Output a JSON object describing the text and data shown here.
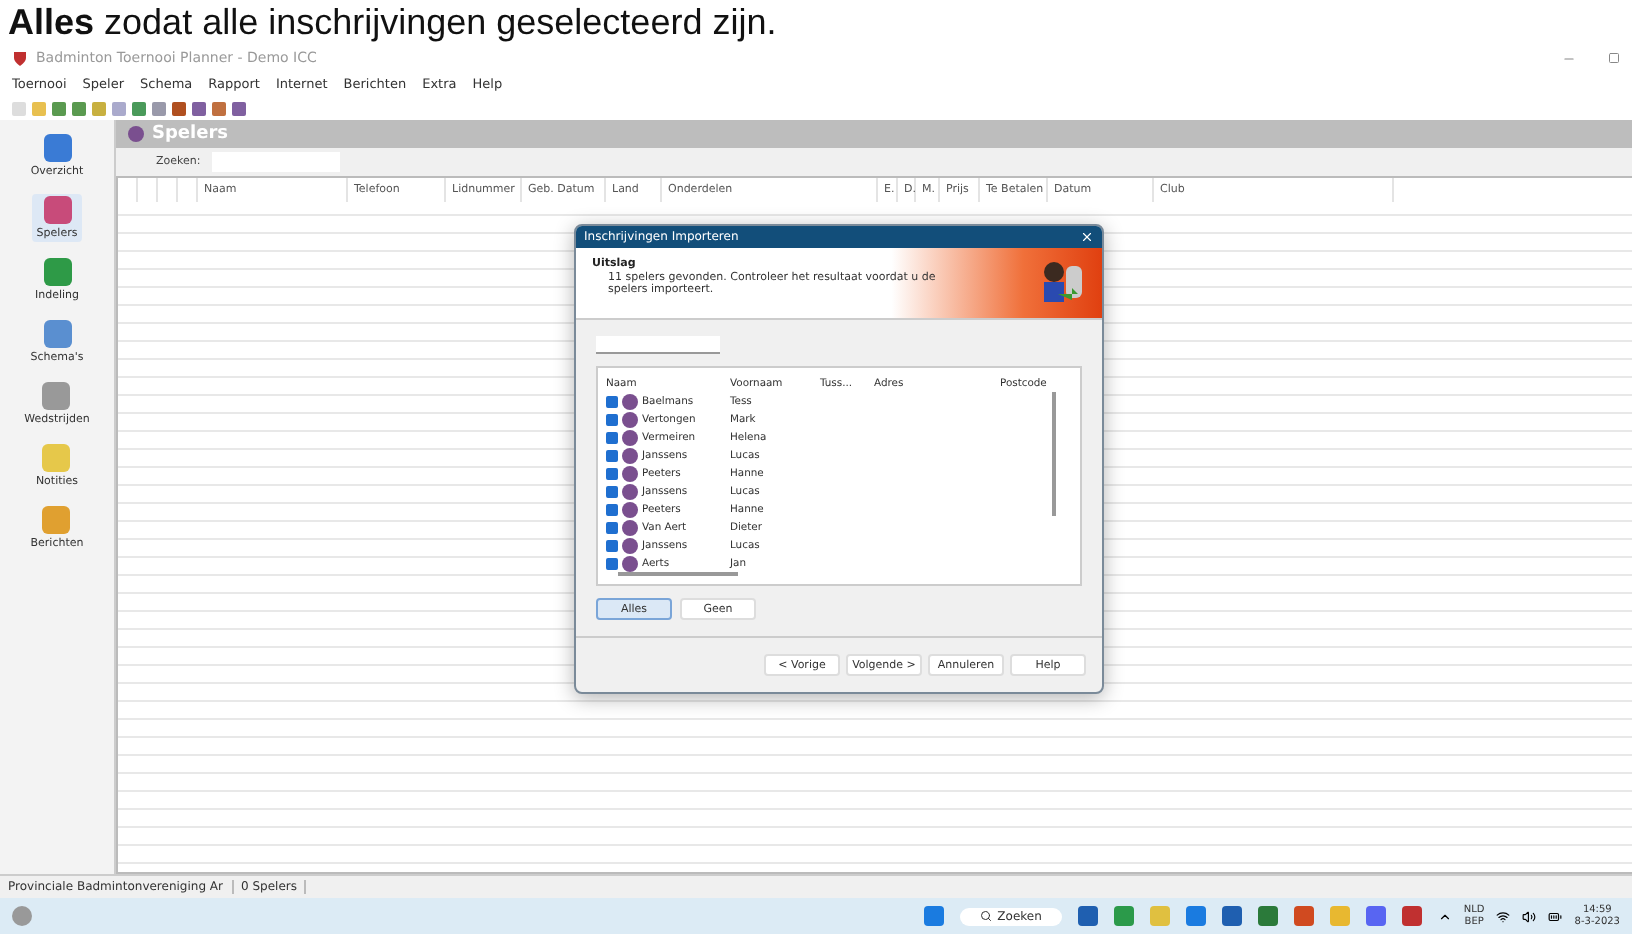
{
  "caption": "**Alles** zodat alle inschrijvingen geselecteerd zijn.",
  "window": {
    "title": "Badminton Toernooi Planner - Demo ICC"
  },
  "menu": [
    "Toernooi",
    "Speler",
    "Schema",
    "Rapport",
    "Internet",
    "Berichten",
    "Extra",
    "Help"
  ],
  "sidebar": {
    "items": [
      {
        "label": "Overzicht",
        "selected": false
      },
      {
        "label": "Spelers",
        "selected": true
      },
      {
        "label": "Indeling",
        "selected": false
      },
      {
        "label": "Schema's",
        "selected": false
      },
      {
        "label": "Wedstrijden",
        "selected": false
      },
      {
        "label": "Notities",
        "selected": false
      },
      {
        "label": "Berichten",
        "selected": false
      }
    ]
  },
  "panel": {
    "title": "Spelers",
    "search_label": "Zoeken:"
  },
  "table": {
    "columns": [
      "",
      "",
      "",
      "",
      "Naam",
      "Telefoon",
      "Lidnummer",
      "Geb. Datum",
      "Land",
      "Onderdelen",
      "E.",
      "D.",
      "M.",
      "Prijs",
      "Te Betalen",
      "Datum",
      "Club"
    ]
  },
  "dialog": {
    "title": "Inschrijvingen Importeren",
    "heading": "Uitslag",
    "message": "11 spelers gevonden. Controleer het resultaat voordat u de spelers importeert.",
    "columns": [
      "Naam",
      "Voornaam",
      "Tuss...",
      "Adres",
      "Postcode"
    ],
    "rows": [
      {
        "checked": true,
        "naam": "Baelmans",
        "voornaam": "Tess"
      },
      {
        "checked": true,
        "naam": "Vertongen",
        "voornaam": "Mark"
      },
      {
        "checked": true,
        "naam": "Vermeiren",
        "voornaam": "Helena"
      },
      {
        "checked": true,
        "naam": "Janssens",
        "voornaam": "Lucas"
      },
      {
        "checked": true,
        "naam": "Peeters",
        "voornaam": "Hanne"
      },
      {
        "checked": true,
        "naam": "Janssens",
        "voornaam": "Lucas"
      },
      {
        "checked": true,
        "naam": "Peeters",
        "voornaam": "Hanne"
      },
      {
        "checked": true,
        "naam": "Van Aert",
        "voornaam": "Dieter"
      },
      {
        "checked": true,
        "naam": "Janssens",
        "voornaam": "Lucas"
      },
      {
        "checked": true,
        "naam": "Aerts",
        "voornaam": "Jan"
      }
    ],
    "select_buttons": [
      {
        "label": "Alles",
        "selected": true
      },
      {
        "label": "Geen",
        "selected": false
      }
    ],
    "buttons": [
      "< Vorige",
      "Volgende >",
      "Annuleren",
      "Help"
    ]
  },
  "status_bar": [
    "Provinciale Badmintonvereniging Ar",
    "0 Spelers"
  ],
  "taskbar": {
    "search": "Zoeken",
    "language": "NLD",
    "layout": "BEP",
    "time": "14:59",
    "date": "8-3-2023"
  }
}
